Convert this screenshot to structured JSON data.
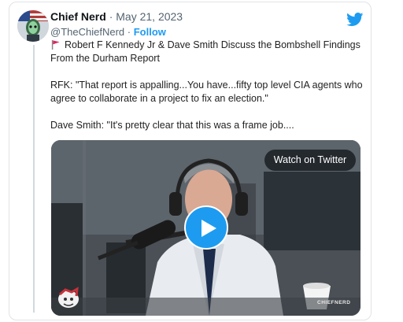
{
  "tweet": {
    "author_name": "Chief Nerd",
    "separator": "·",
    "date": "May 21, 2023",
    "handle": "@TheChiefNerd",
    "handle_separator": "·",
    "follow_label": "Follow",
    "headline": "Robert F Kennedy Jr & Dave Smith Discuss the Bombshell Findings From the Durham Report",
    "quote_rfk": "RFK: \"That report is appalling...You have...fifty top level CIA agents who agree to collaborate in a project to fix an election.\"",
    "quote_dave": "Dave Smith: \"It's pretty clear that this was a frame job...."
  },
  "video": {
    "watch_label": "Watch on Twitter",
    "watermark": "CHIEFNERD"
  },
  "colors": {
    "accent": "#1d9bf0",
    "text": "#0f1419",
    "muted": "#536471",
    "flag": "#e0245e"
  },
  "icons": [
    "twitter-bird-icon",
    "red-flag-icon",
    "play-icon"
  ]
}
